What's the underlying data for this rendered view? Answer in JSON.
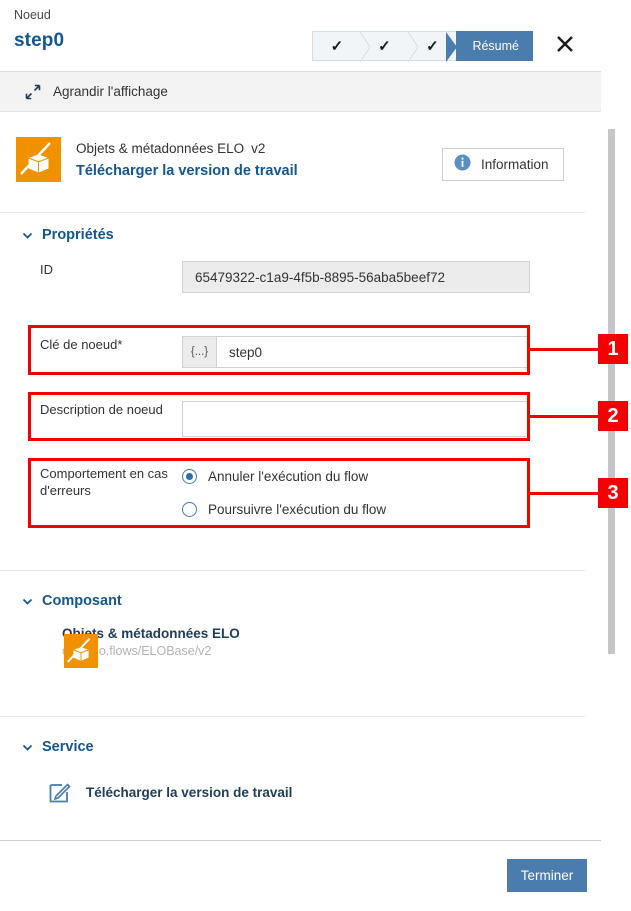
{
  "header": {
    "breadcrumb": "Noeud",
    "title": "step0",
    "close_icon": "close-icon",
    "stepper": {
      "completed_glyph": "✓",
      "steps": [
        {
          "label": "",
          "state": "completed"
        },
        {
          "label": "",
          "state": "completed"
        },
        {
          "label": "",
          "state": "completed"
        },
        {
          "label": "Résumé",
          "state": "active"
        }
      ]
    }
  },
  "expandbar": {
    "label": "Agrandir l'affichage",
    "icon": "expand-diagonal-icon"
  },
  "component_banner": {
    "logo": "elo-cube-logo",
    "name": "Objets & métadonnées ELO",
    "version": "v2",
    "action": "Télécharger la version de travail",
    "info_button": {
      "label": "Information",
      "icon": "info-icon"
    }
  },
  "properties": {
    "section_title": "Propriétés",
    "caret": "chevron-down-icon",
    "fields": {
      "id": {
        "label": "ID",
        "value": "65479322-c1a9-4f5b-8895-56aba5beef72"
      },
      "node_key": {
        "label": "Clé de noeud*",
        "prefix": "{...}",
        "value": "step0"
      },
      "node_description": {
        "label": "Description de noeud",
        "value": "",
        "placeholder": ""
      },
      "error_behavior": {
        "label": "Comportement en cas d'erreurs",
        "options": [
          {
            "label": "Annuler l'exécution du flow",
            "selected": true
          },
          {
            "label": "Poursuivre l'exécution du flow",
            "selected": false
          }
        ]
      }
    }
  },
  "composant": {
    "section_title": "Composant",
    "caret": "chevron-down-icon",
    "item": {
      "logo": "elo-cube-logo",
      "title": "Objets & métadonnées ELO",
      "subtitle": "com.elo.flows/ELOBase/v2"
    }
  },
  "service": {
    "section_title": "Service",
    "caret": "chevron-down-icon",
    "item": {
      "icon": "edit-square-icon",
      "title": "Télécharger la version de travail"
    }
  },
  "footer": {
    "primary_button": "Terminer"
  },
  "annotations": [
    {
      "number": "1"
    },
    {
      "number": "2"
    },
    {
      "number": "3"
    }
  ],
  "colors": {
    "brand_blue": "#14568f",
    "accent_blue": "#4a7cad",
    "elo_orange": "#f09200",
    "annotation_red": "#f50000"
  }
}
